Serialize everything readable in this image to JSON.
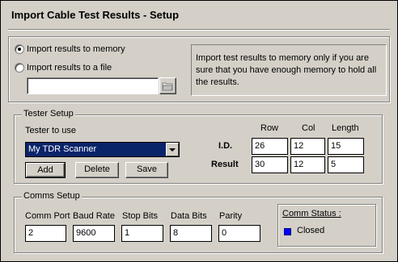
{
  "window": {
    "title": "Import Cable Test Results - Setup"
  },
  "import": {
    "option_memory": "Import results to memory",
    "option_file": "Import results to a file",
    "selected": "memory",
    "file_path": "",
    "info_text": "Import test results to memory only if you are sure that you have enough memory to hold all the results."
  },
  "tester_setup": {
    "legend": "Tester Setup",
    "tester_label": "Tester to use",
    "tester_selected": "My TDR Scanner",
    "buttons": {
      "add": "Add",
      "delete": "Delete",
      "save": "Save"
    },
    "columns": {
      "row": "Row",
      "col": "Col",
      "length": "Length"
    },
    "id_label": "I.D.",
    "result_label": "Result",
    "id": {
      "row": "26",
      "col": "12",
      "length": "15"
    },
    "result": {
      "row": "30",
      "col": "12",
      "length": "5"
    }
  },
  "comms_setup": {
    "legend": "Comms Setup",
    "labels": {
      "port": "Comm Port",
      "baud": "Baud Rate",
      "stop": "Stop Bits",
      "data": "Data Bits",
      "parity": "Parity"
    },
    "values": {
      "port": "2",
      "baud": "9600",
      "stop": "1",
      "data": "8",
      "parity": "0"
    },
    "status_label": "Comm Status :",
    "status_value": "Closed",
    "status_color": "#0000ff"
  }
}
